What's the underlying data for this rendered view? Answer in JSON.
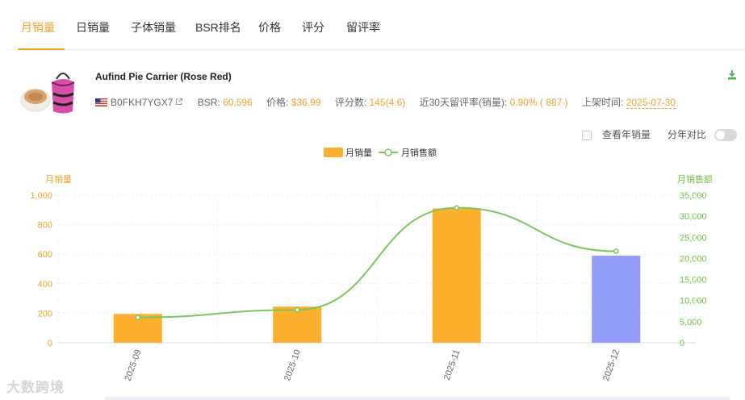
{
  "tabs": [
    {
      "label": "月销量",
      "active": true
    },
    {
      "label": "日销量"
    },
    {
      "label": "子体销量"
    },
    {
      "label": "BSR排名"
    },
    {
      "label": "价格"
    },
    {
      "label": "评分"
    },
    {
      "label": "留评率"
    }
  ],
  "product": {
    "title": "Aufind Pie Carrier (Rose Red)",
    "asin": "B0FKH7YGX7",
    "bsr_label": "BSR:",
    "bsr_value": "60,596",
    "price_label": "价格:",
    "price_value": "$36.99",
    "ratings_label": "评分数:",
    "ratings_value": "145(4.6)",
    "review_rate_label": "近30天留评率(销量):",
    "review_rate_value": "0.90% ( 887 )",
    "launch_label": "上架时间:",
    "launch_value": "2025-07-30"
  },
  "options": {
    "yearly_label": "查看年销量",
    "yoy_label": "分年对比"
  },
  "icons": {
    "download": "download-icon",
    "external_link": "external-link-icon",
    "flag": "us-flag-icon"
  },
  "watermark": "大数跨境",
  "chart_data": {
    "type": "bar",
    "categories": [
      "2025-09",
      "2025-10",
      "2025-11",
      "2025-12"
    ],
    "series": [
      {
        "name": "月销量",
        "type": "bar",
        "axis": "left",
        "values": [
          195,
          245,
          910,
          590
        ],
        "colors": [
          "#fcb02d",
          "#fcb02d",
          "#fcb02d",
          "#939ef8"
        ]
      },
      {
        "name": "月销售额",
        "type": "line",
        "axis": "right",
        "values": [
          6000,
          7800,
          32000,
          21700
        ],
        "color": "#7ac75e"
      }
    ],
    "ylabel": "月销量",
    "y2label": "月销售额",
    "ylim": [
      0,
      1000
    ],
    "y_ticks": [
      "0",
      "200",
      "400",
      "600",
      "800",
      "1,000"
    ],
    "y2lim": [
      0,
      35000
    ],
    "y2_ticks": [
      "0",
      "5,000",
      "10,000",
      "15,000",
      "20,000",
      "25,000",
      "30,000",
      "35,000"
    ],
    "legend_position": "top-center",
    "grid": true,
    "left_axis_color": "#f0a329",
    "right_axis_color": "#72c04a"
  }
}
